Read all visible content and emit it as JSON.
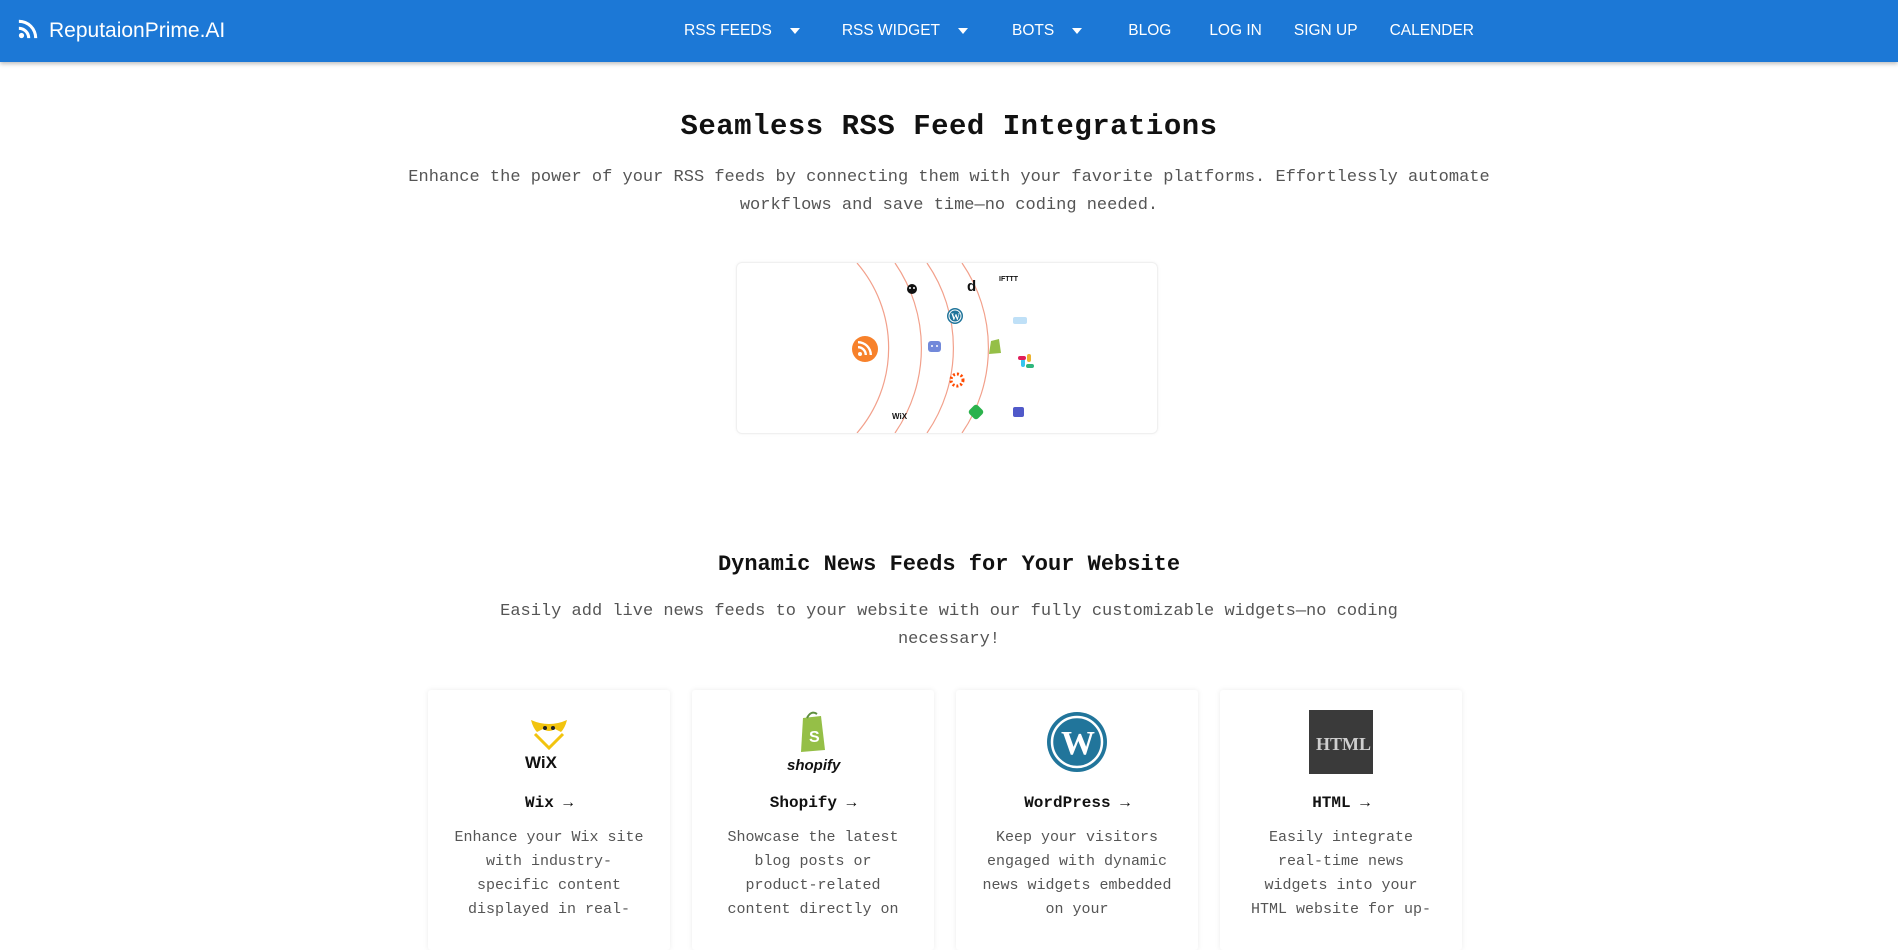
{
  "brand": {
    "name": "ReputaionPrime.AI",
    "icon": "rss-icon"
  },
  "nav": {
    "items": [
      {
        "label": "RSS FEEDS",
        "dropdown": true
      },
      {
        "label": "RSS WIDGET",
        "dropdown": true
      },
      {
        "label": "BOTS",
        "dropdown": true
      },
      {
        "label": "BLOG",
        "dropdown": false
      },
      {
        "label": "LOG IN",
        "dropdown": false
      },
      {
        "label": "SIGN UP",
        "dropdown": false
      },
      {
        "label": "CALENDER",
        "dropdown": false
      }
    ]
  },
  "integrations": {
    "title": "Seamless RSS Feed Integrations",
    "description": "Enhance the power of your RSS feeds by connecting them with your favorite platforms. Effortlessly automate workflows and save time—no coding needed.",
    "logo_text": {
      "d": "d",
      "ifttt": "IFTTT",
      "wix": "WiX"
    }
  },
  "widgets": {
    "title": "Dynamic News Feeds for Your Website",
    "description": "Easily add live news feeds to your website with our fully customizable widgets—no coding necessary!",
    "cards": [
      {
        "title": "Wix →",
        "description": "Enhance your Wix site with industry-specific content displayed in real-",
        "logo_text": "WiX"
      },
      {
        "title": "Shopify →",
        "description": "Showcase the latest blog posts or product-related content directly on",
        "logo_text": "shopify"
      },
      {
        "title": "WordPress →",
        "description": "Keep your visitors engaged with dynamic news widgets embedded on your",
        "logo_text": "W"
      },
      {
        "title": "HTML →",
        "description": "Easily integrate real-time news widgets into your HTML website for up-",
        "logo_text": "HTML"
      }
    ]
  },
  "colors": {
    "navbar": "#1c78d6",
    "rss_orange": "#f7812b",
    "orbit": "#f2a08b"
  }
}
